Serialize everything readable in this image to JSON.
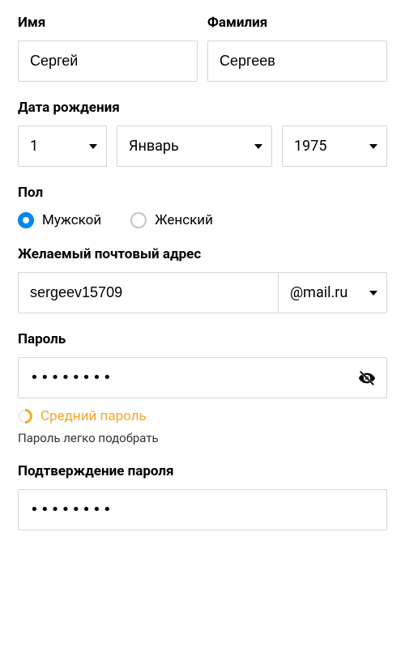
{
  "name": {
    "firstLabel": "Имя",
    "firstValue": "Сергей",
    "lastLabel": "Фамилия",
    "lastValue": "Сергеев"
  },
  "birth": {
    "label": "Дата рождения",
    "day": "1",
    "month": "Январь",
    "year": "1975"
  },
  "gender": {
    "label": "Пол",
    "male": "Мужской",
    "female": "Женский",
    "selected": "male"
  },
  "email": {
    "label": "Желаемый почтовый адрес",
    "username": "sergeev15709",
    "domain": "@mail.ru"
  },
  "password": {
    "label": "Пароль",
    "masked": "••••••••",
    "strengthLabel": "Средний пароль",
    "hint": "Пароль легко подобрать"
  },
  "confirm": {
    "label": "Подтверждение пароля",
    "masked": "••••••••"
  },
  "colors": {
    "accent": "#0088ee",
    "warning": "#f7a623"
  }
}
